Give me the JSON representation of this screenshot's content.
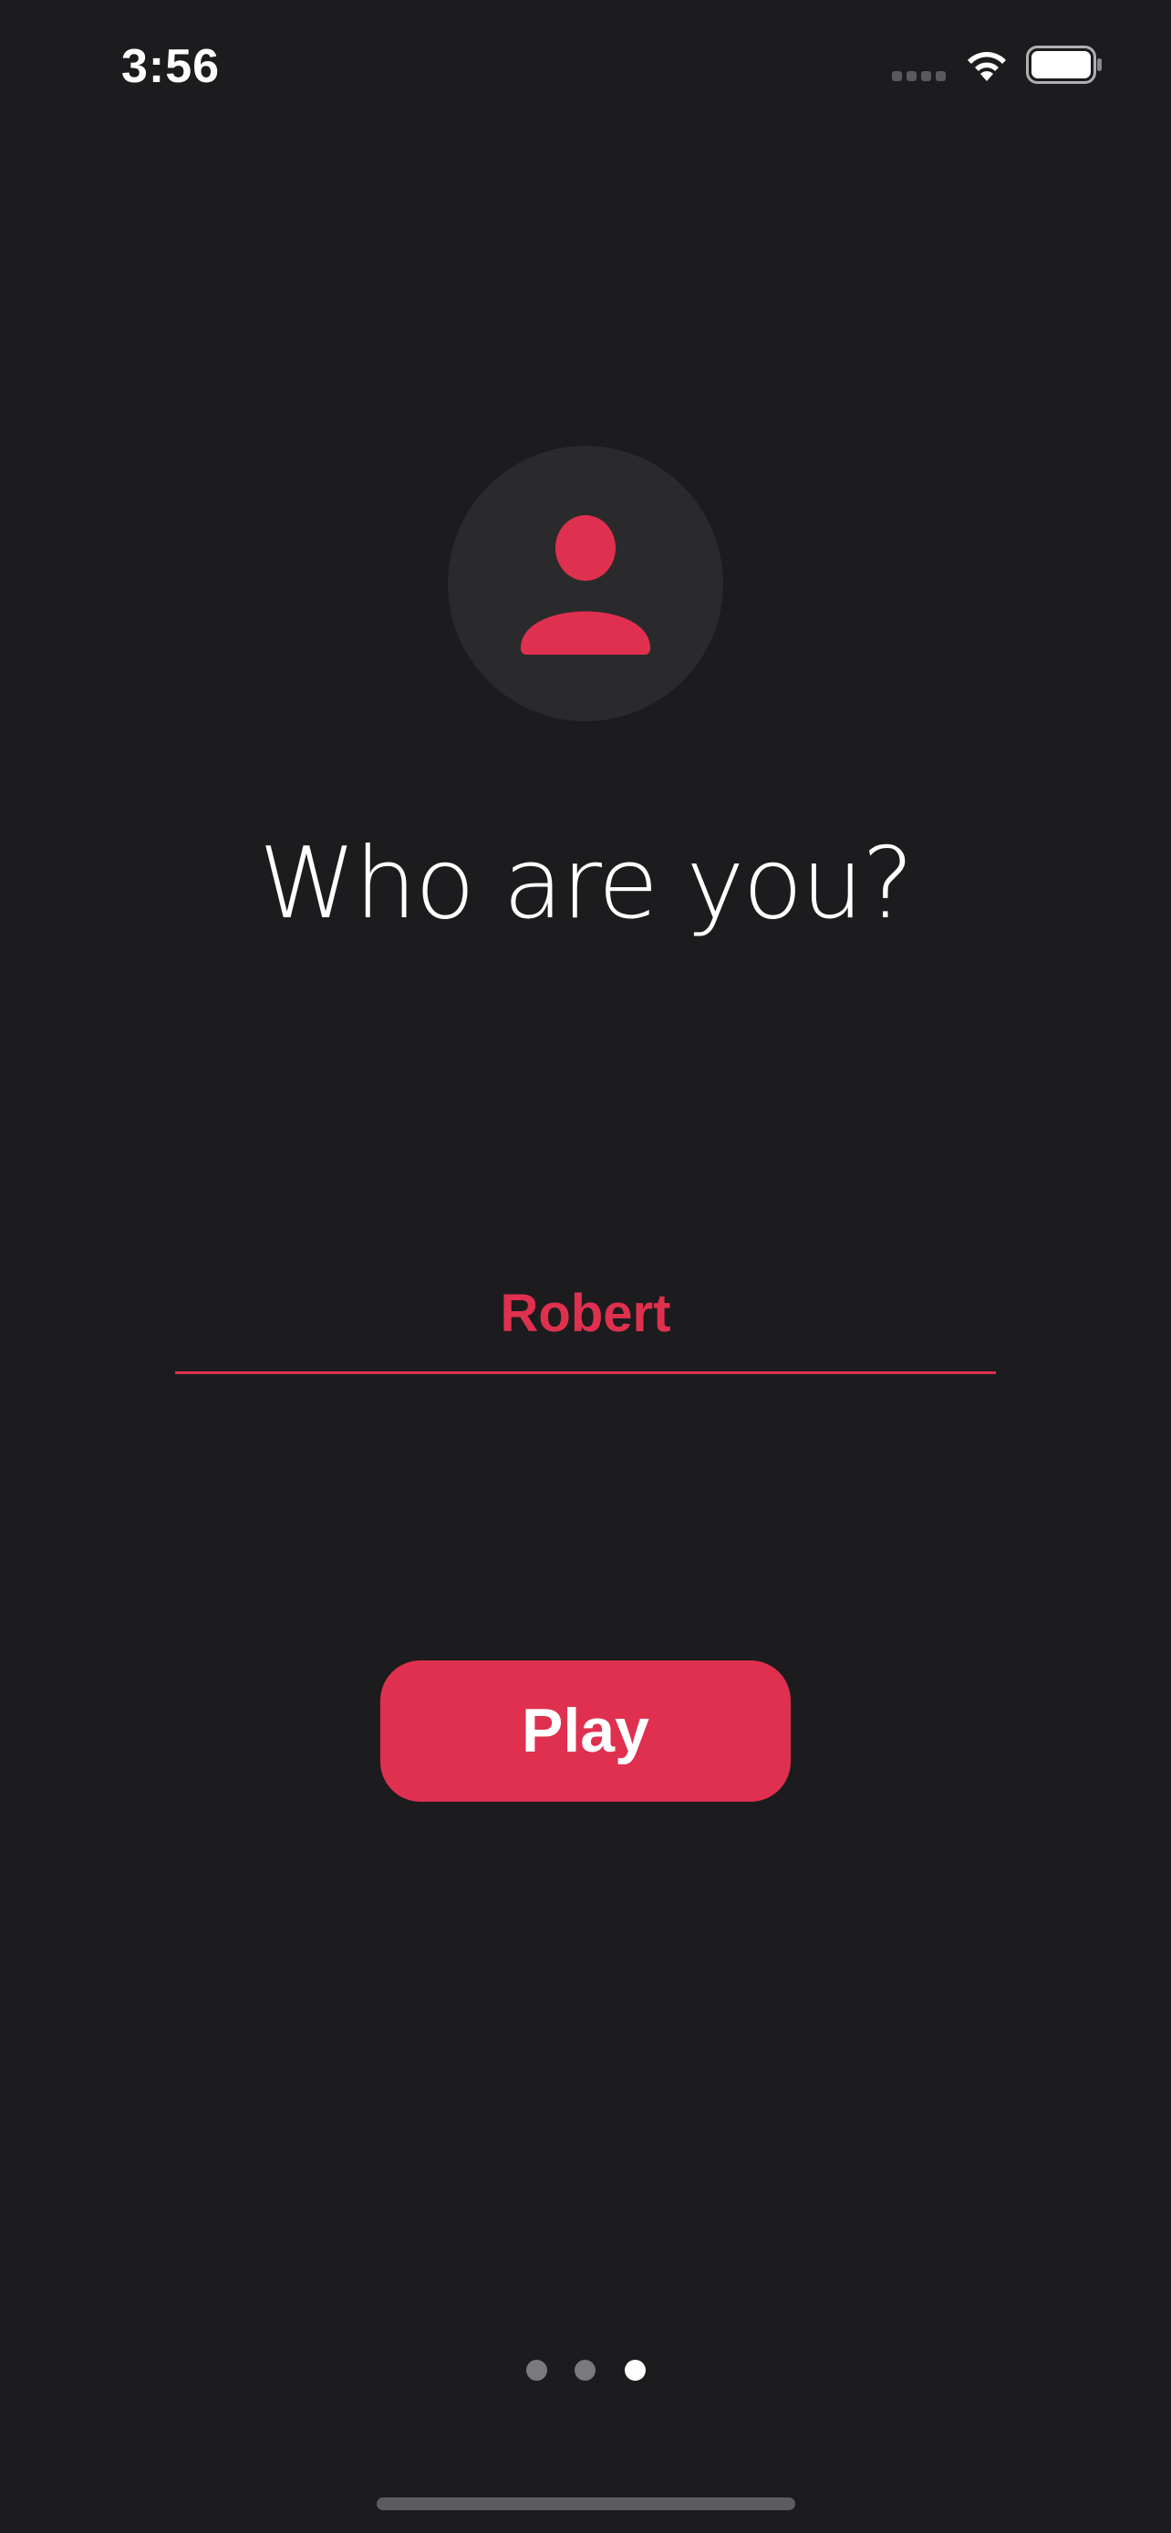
{
  "status_bar": {
    "time": "3:56",
    "signal_icon": "cellular-signal-icon",
    "wifi_icon": "wifi-icon",
    "battery_icon": "battery-icon",
    "battery_level": 1.0
  },
  "avatar": {
    "icon": "person-icon"
  },
  "title": "Who are you?",
  "name_input": {
    "value": "Robert"
  },
  "play_button": {
    "label": "Play"
  },
  "page_indicator": {
    "total": 3,
    "current": 3
  },
  "colors": {
    "background": "#1c1c1e",
    "accent": "#e0304f",
    "avatar_circle": "#2a2a2c",
    "text": "#ffffff"
  }
}
